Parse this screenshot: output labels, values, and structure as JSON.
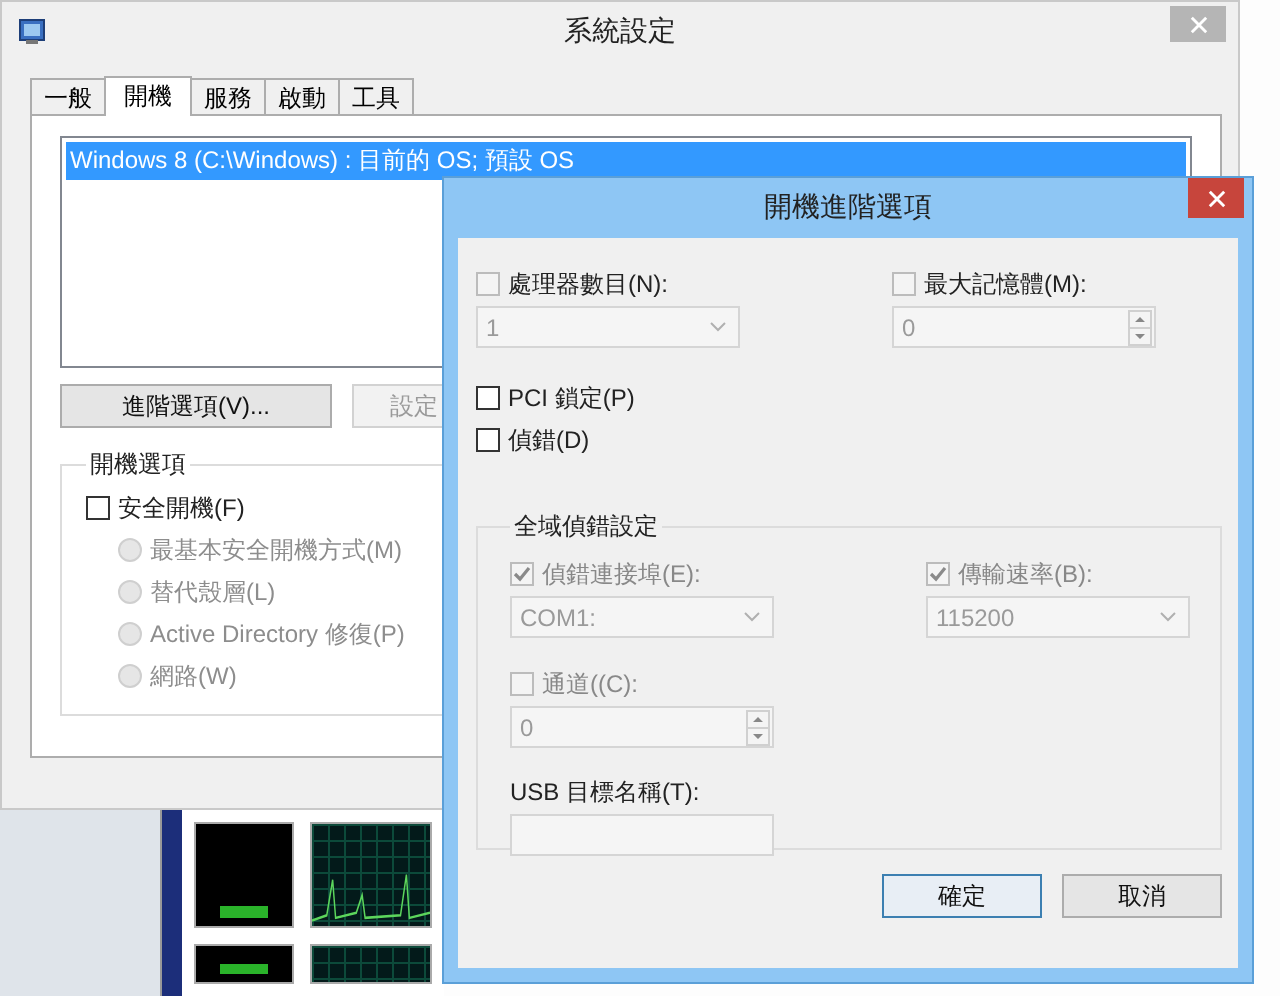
{
  "main_window": {
    "title": "系統設定",
    "tabs": [
      {
        "label": "一般",
        "selected": false
      },
      {
        "label": "開機",
        "selected": true
      },
      {
        "label": "服務",
        "selected": false
      },
      {
        "label": "啟動",
        "selected": false
      },
      {
        "label": "工具",
        "selected": false
      }
    ],
    "boot_list": [
      {
        "label": "Windows 8 (C:\\Windows) : 目前的 OS; 預設 OS",
        "selected": true
      }
    ],
    "buttons": [
      {
        "label": "進階選項(V)...",
        "disabled": false
      },
      {
        "label": "設定",
        "disabled": true
      }
    ],
    "boot_options": {
      "title": "開機選項",
      "safe_boot": {
        "label": "安全開機(F)",
        "checked": false
      },
      "modes": [
        {
          "label": "最基本安全開機方式(M)",
          "selected": false,
          "disabled": true
        },
        {
          "label": "替代殼層(L)",
          "selected": false,
          "disabled": true
        },
        {
          "label": "Active Directory 修復(P)",
          "selected": false,
          "disabled": true
        },
        {
          "label": "網路(W)",
          "selected": false,
          "disabled": true
        }
      ]
    }
  },
  "dialog": {
    "title": "開機進階選項",
    "top_fields": [
      {
        "label": "處理器數目(N):",
        "checked": false,
        "disabled": true,
        "kind": "combo",
        "value": "1"
      },
      {
        "label": "最大記憶體(M):",
        "checked": false,
        "disabled": true,
        "kind": "spin",
        "value": "0"
      }
    ],
    "options": [
      {
        "label": "PCI 鎖定(P)",
        "checked": false
      },
      {
        "label": "偵錯(D)",
        "checked": false
      }
    ],
    "debug": {
      "title": "全域偵錯設定",
      "fields": [
        {
          "label": "偵錯連接埠(E):",
          "checked": true,
          "disabled": true,
          "kind": "combo",
          "value": "COM1:"
        },
        {
          "label": "傳輸速率(B):",
          "checked": true,
          "disabled": true,
          "kind": "combo",
          "value": "115200"
        },
        {
          "label": "通道((C):",
          "checked": false,
          "disabled": true,
          "kind": "spin",
          "value": "0"
        }
      ],
      "usb": {
        "label": "USB 目標名稱(T):",
        "disabled": true
      }
    },
    "buttons": [
      {
        "label": "確定",
        "default": true
      },
      {
        "label": "取消",
        "default": false
      }
    ]
  }
}
